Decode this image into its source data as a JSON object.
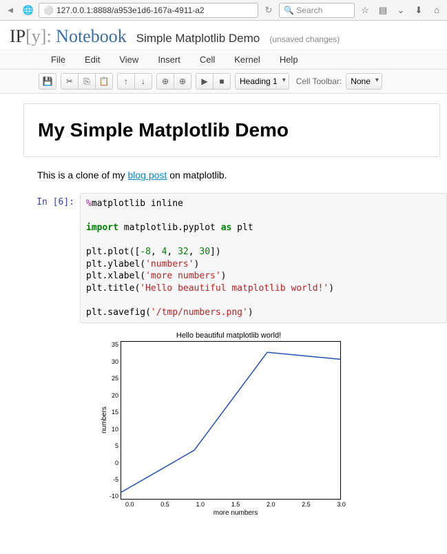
{
  "browser": {
    "url": "127.0.0.1:8888/a953e1d6-167a-4911-a2",
    "search_placeholder": "Search"
  },
  "header": {
    "logo_ip": "IP",
    "logo_y": "[y]:",
    "logo_nb": "Notebook",
    "title": "Simple Matplotlib Demo",
    "status": "(unsaved changes)"
  },
  "menubar": [
    "File",
    "Edit",
    "View",
    "Insert",
    "Cell",
    "Kernel",
    "Help"
  ],
  "toolbar": {
    "cell_type": "Heading 1",
    "cell_toolbar_label": "Cell Toolbar:",
    "cell_toolbar_value": "None"
  },
  "cells": {
    "heading": "My Simple Matplotlib Demo",
    "markdown_pre": "This is a clone of my ",
    "markdown_link": "blog post",
    "markdown_post": " on matplotlib.",
    "prompt": "In [6]:",
    "code": {
      "l1a": "%",
      "l1b": "matplotlib inline",
      "l3a": "import",
      "l3b": " matplotlib.pyplot ",
      "l3c": "as",
      "l3d": " plt",
      "l5a": "plt.plot([",
      "l5b": "-8",
      "l5c": ", ",
      "l5d": "4",
      "l5e": ", ",
      "l5f": "32",
      "l5g": ", ",
      "l5h": "30",
      "l5i": "])",
      "l6a": "plt.ylabel(",
      "l6b": "'numbers'",
      "l6c": ")",
      "l7a": "plt.xlabel(",
      "l7b": "'more numbers'",
      "l7c": ")",
      "l8a": "plt.title(",
      "l8b": "'Hello beautiful matplotlib world!'",
      "l8c": ")",
      "l10a": "plt.savefig(",
      "l10b": "'/tmp/numbers.png'",
      "l10c": ")"
    }
  },
  "chart_data": {
    "type": "line",
    "title": "Hello beautiful matplotlib world!",
    "xlabel": "more numbers",
    "ylabel": "numbers",
    "x": [
      0.0,
      1.0,
      2.0,
      3.0
    ],
    "y": [
      -8,
      4,
      32,
      30
    ],
    "xticks": [
      "0.0",
      "0.5",
      "1.0",
      "1.5",
      "2.0",
      "2.5",
      "3.0"
    ],
    "yticks": [
      "35",
      "30",
      "25",
      "20",
      "15",
      "10",
      "5",
      "0",
      "-5",
      "-10"
    ],
    "xlim": [
      0.0,
      3.0
    ],
    "ylim": [
      -10,
      35
    ]
  }
}
